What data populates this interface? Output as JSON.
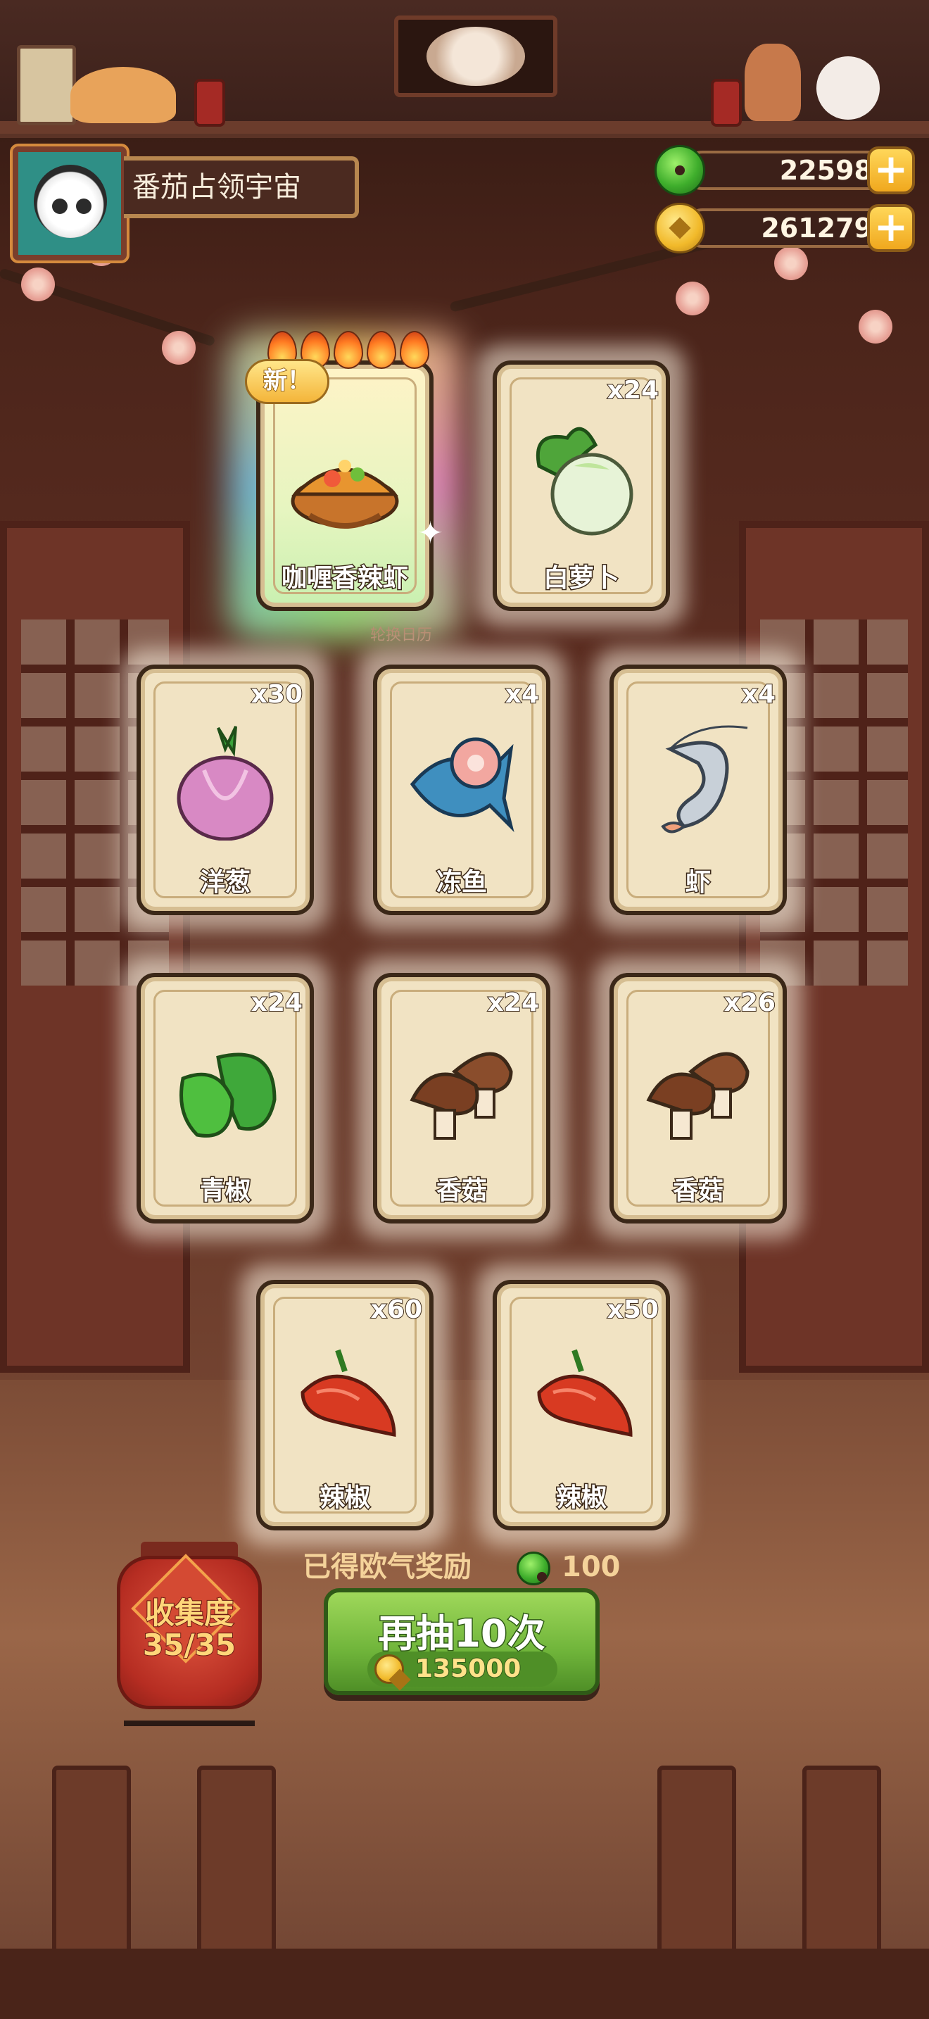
{
  "player": {
    "name": "番茄占领宇宙"
  },
  "currency": {
    "jade": {
      "icon": "jade-coin-icon",
      "value": "22598",
      "add": "+"
    },
    "gold": {
      "icon": "gold-coin-icon",
      "value": "261279",
      "add": "+"
    }
  },
  "featured": {
    "badge": "新！",
    "name": "咖喱香辣虾",
    "rating_flames": 5,
    "caption": "轮换日历"
  },
  "cards": [
    {
      "name": "白萝卜",
      "count": "x24",
      "icon": "radish-icon"
    },
    {
      "name": "洋葱",
      "count": "x30",
      "icon": "onion-icon"
    },
    {
      "name": "冻鱼",
      "count": "x4",
      "icon": "fish-icon"
    },
    {
      "name": "虾",
      "count": "x4",
      "icon": "shrimp-icon"
    },
    {
      "name": "青椒",
      "count": "x24",
      "icon": "green-pepper-icon"
    },
    {
      "name": "香菇",
      "count": "x24",
      "icon": "mushroom-icon"
    },
    {
      "name": "香菇",
      "count": "x26",
      "icon": "mushroom-icon"
    },
    {
      "name": "辣椒",
      "count": "x60",
      "icon": "chili-icon"
    },
    {
      "name": "辣椒",
      "count": "x50",
      "icon": "chili-icon"
    }
  ],
  "reward": {
    "label": "已得欧气奖励",
    "value": "100",
    "icon": "jade-coin-icon"
  },
  "collection": {
    "title": "收集度",
    "value": "35/35"
  },
  "draw_button": {
    "label": "再抽10次",
    "price": "135000",
    "price_icon": "gold-coin-icon"
  },
  "colors": {
    "card_bg": "#f1e3c3",
    "card_border": "#3b2818",
    "button_green": "#6fb43a",
    "accent_gold": "#f4d29a"
  }
}
